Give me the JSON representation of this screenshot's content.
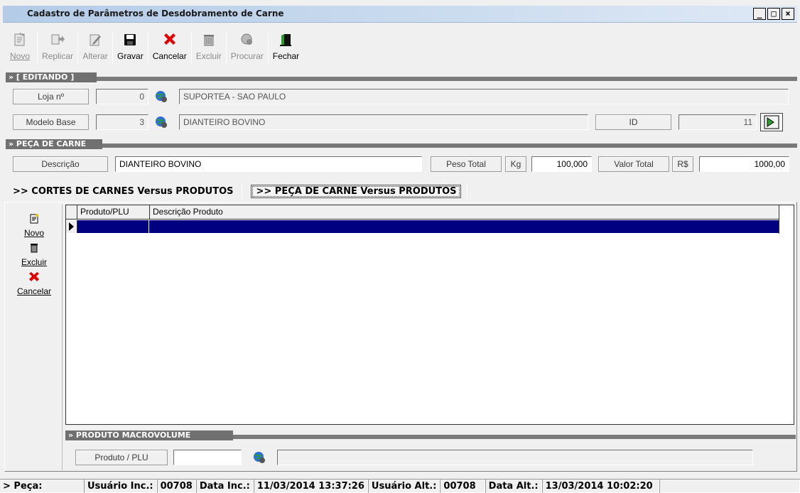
{
  "window": {
    "title": "Cadastro de Parâmetros de Desdobramento de Carne",
    "min": "_",
    "max": "□",
    "close": "×"
  },
  "toolbar": {
    "novo": "Novo",
    "replicar": "Replicar",
    "alterar": "Alterar",
    "gravar": "Gravar",
    "cancelar": "Cancelar",
    "excluir": "Excluir",
    "procurar": "Procurar",
    "fechar": "Fechar"
  },
  "editando": {
    "header": "» [ EDITANDO ]",
    "loja_label": "Loja nº",
    "loja_num": "0",
    "loja_nome": "SUPORTEA - SAO PAULO",
    "modelo_label": "Modelo Base",
    "modelo_num": "3",
    "modelo_nome": "DIANTEIRO BOVINO",
    "id_label": "ID",
    "id_value": "11"
  },
  "peca": {
    "header": "» PEÇA DE CARNE",
    "descricao_label": "Descrição",
    "descricao_value": "DIANTEIRO BOVINO",
    "peso_label": "Peso Total",
    "peso_unit": "Kg",
    "peso_value": "100,000",
    "valor_label": "Valor Total",
    "valor_unit": "R$",
    "valor_value": "1000,00"
  },
  "tabs": {
    "tab1": ">> CORTES DE CARNES Versus PRODUTOS",
    "tab2": ">> PEÇA DE CARNE Versus PRODUTOS"
  },
  "sidebar": {
    "novo": "Novo",
    "excluir": "Excluir",
    "cancelar": "Cancelar"
  },
  "grid": {
    "columns": [
      "Produto/PLU",
      "Descrição Produto"
    ],
    "rows": [
      [
        "",
        ""
      ]
    ]
  },
  "macro": {
    "header": "» PRODUTO MACROVOLUME",
    "produto_label": "Produto / PLU",
    "produto_value": "",
    "descricao_value": ""
  },
  "status": {
    "peca": "> Peça:",
    "usuario_inc_label": "Usuário Inc.:",
    "usuario_inc": "00708",
    "data_inc_label": "Data Inc.:",
    "data_inc": "11/03/2014 13:37:26",
    "usuario_alt_label": "Usuário Alt.:",
    "usuario_alt": "00708",
    "data_alt_label": "Data Alt.:",
    "data_alt": "13/03/2014 10:02:20"
  },
  "colors": {
    "selection": "#000080",
    "titlebar": "#c8daee",
    "section": "#707070"
  }
}
